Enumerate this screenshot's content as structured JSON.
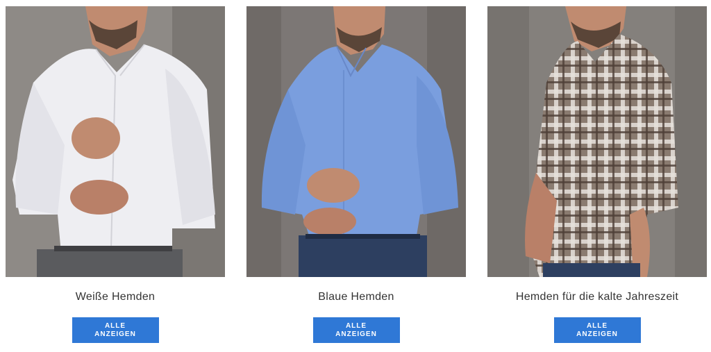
{
  "products": [
    {
      "title": "Weiße Hemden",
      "button_line1": "ALLE",
      "button_line2": "ANZEIGEN",
      "shirt_color": "#eeeef2",
      "backdrop": "#8e8a86"
    },
    {
      "title": "Blaue Hemden",
      "button_line1": "ALLE",
      "button_line2": "ANZEIGEN",
      "shirt_color": "#7a9ede",
      "backdrop": "#7c7775"
    },
    {
      "title": "Hemden für die kalte Jahreszeit",
      "button_line1": "ALLE",
      "button_line2": "ANZEIGEN",
      "shirt_color": "#8a7b70",
      "backdrop": "#84807c"
    }
  ],
  "colors": {
    "button": "#2f78d6",
    "title_text": "#333333",
    "skin": "#c08b70"
  }
}
